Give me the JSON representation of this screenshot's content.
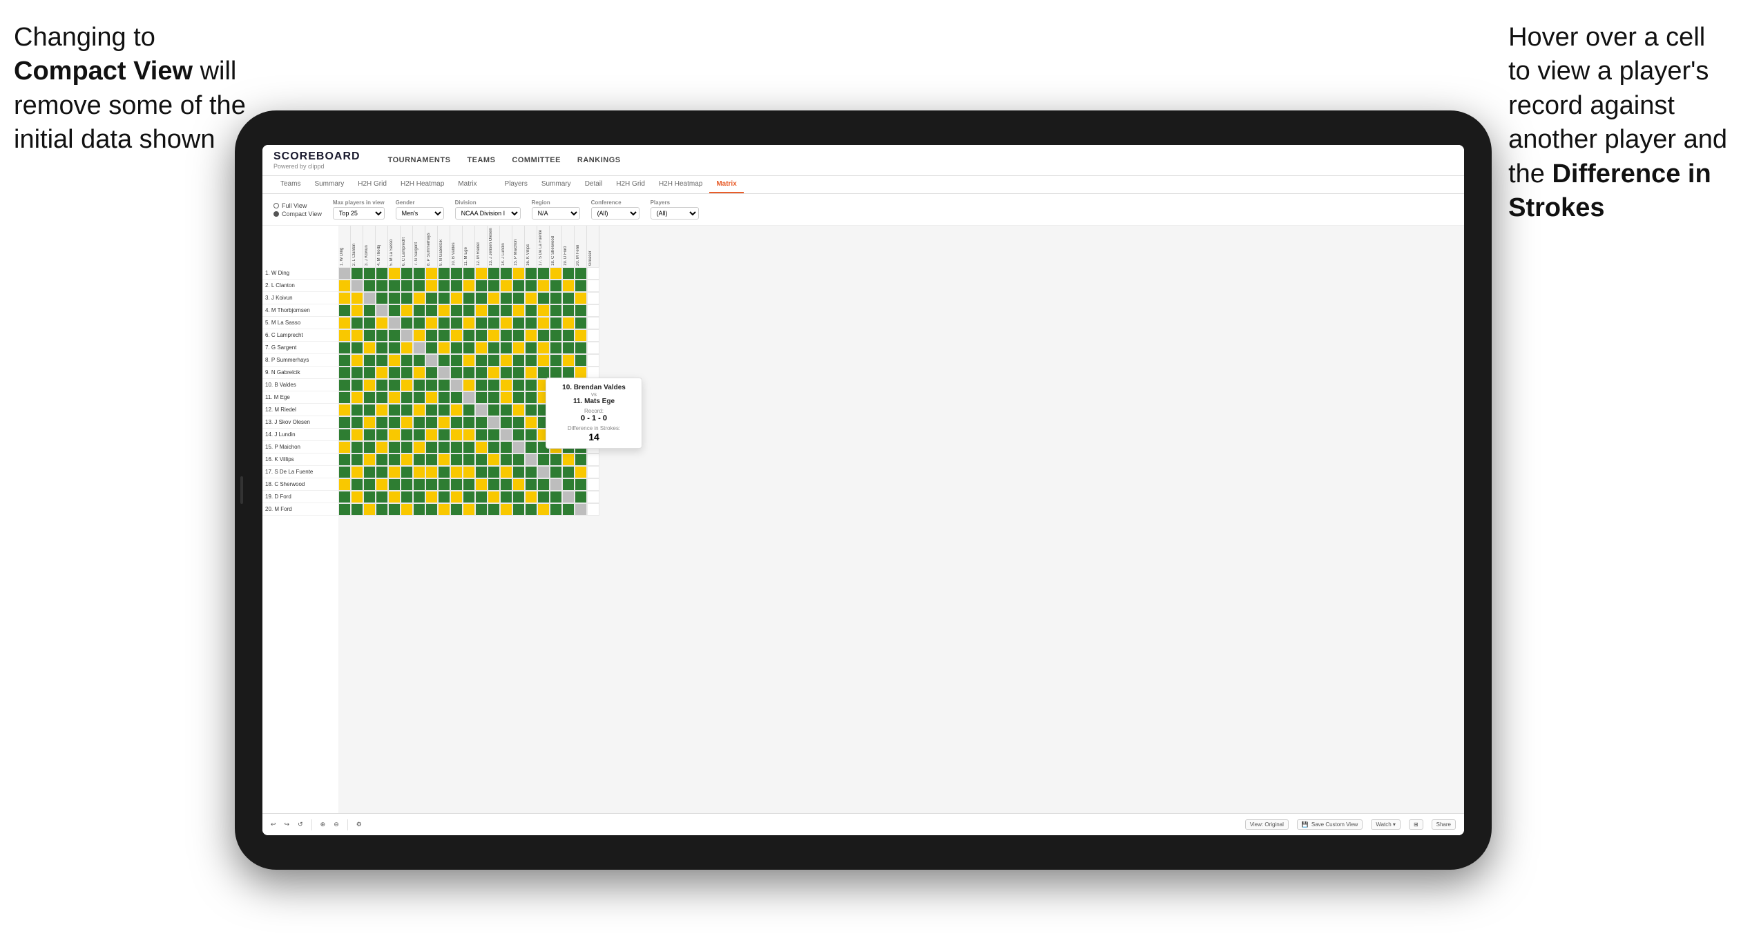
{
  "annotation_left": {
    "line1": "Changing to",
    "line2_bold": "Compact View",
    "line2_rest": " will",
    "line3": "remove some of the",
    "line4": "initial data shown"
  },
  "annotation_right": {
    "line1": "Hover over a cell",
    "line2": "to view a player's",
    "line3": "record against",
    "line4": "another player and",
    "line5_pre": "the ",
    "line5_bold": "Difference in",
    "line6_bold": "Strokes"
  },
  "nav": {
    "logo": "SCOREBOARD",
    "powered_by": "Powered by clippd",
    "items": [
      "TOURNAMENTS",
      "TEAMS",
      "COMMITTEE",
      "RANKINGS"
    ]
  },
  "sub_nav": {
    "tabs": [
      "Teams",
      "Summary",
      "H2H Grid",
      "H2H Heatmap",
      "Matrix",
      "Players",
      "Summary",
      "Detail",
      "H2H Grid",
      "H2H Heatmap",
      "Matrix"
    ],
    "active": "Matrix"
  },
  "filters": {
    "view_options": [
      "Full View",
      "Compact View"
    ],
    "selected_view": "Compact View",
    "max_players_label": "Max players in view",
    "max_players_value": "Top 25",
    "gender_label": "Gender",
    "gender_value": "Men's",
    "division_label": "Division",
    "division_value": "NCAA Division I",
    "region_label": "Region",
    "region_value": "N/A",
    "conference_label": "Conference",
    "conference_value": "(All)",
    "players_label": "Players",
    "players_value": "(All)"
  },
  "players": [
    "1. W Ding",
    "2. L Clanton",
    "3. J Koivun",
    "4. M Thorbjornsen",
    "5. M La Sasso",
    "6. C Lamprecht",
    "7. G Sargent",
    "8. P Summerhays",
    "9. N Gabrelcik",
    "10. B Valdes",
    "11. M Ege",
    "12. M Riedel",
    "13. J Skov Olesen",
    "14. J Lundin",
    "15. P Maichon",
    "16. K Villips",
    "17. S De La Fuente",
    "18. C Sherwood",
    "19. D Ford",
    "20. M Ford"
  ],
  "col_headers": [
    "1. W Ding",
    "2. L Clanton",
    "3. J Koivun",
    "4. M Thorbj",
    "5. M La Sasso",
    "6. C Lamprecht",
    "7. G Sargent",
    "8. P Summerhays",
    "9. N Gabrelcik",
    "10. B Valdes",
    "11. M Ege",
    "12. M Riedel",
    "13. J Jensen Olesen",
    "14. J Lundin",
    "15. P Maichon",
    "16. K Villips",
    "17. S De La Fuente",
    "18. C Sherwood",
    "19. D Ford",
    "20. M Fenn",
    "Greaser"
  ],
  "tooltip": {
    "player1": "10. Brendan Valdes",
    "vs": "vs",
    "player2": "11. Mats Ege",
    "record_label": "Record:",
    "record": "0 - 1 - 0",
    "diff_label": "Difference in Strokes:",
    "diff": "14"
  },
  "bottom_bar": {
    "view_original": "View: Original",
    "save_custom": "Save Custom View",
    "watch": "Watch ▾",
    "share": "Share"
  }
}
